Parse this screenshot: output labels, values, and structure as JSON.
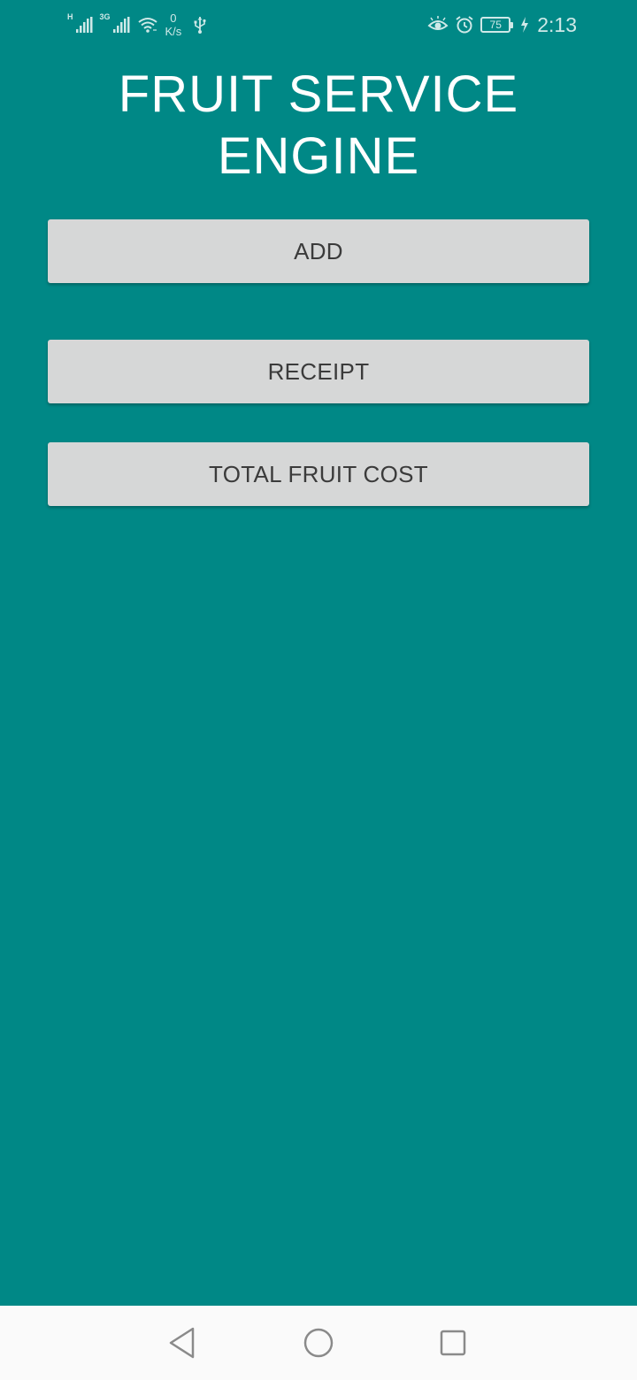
{
  "status_bar": {
    "network_1": "H",
    "network_2": "3G",
    "speed_value": "0",
    "speed_unit": "K/s",
    "battery": "75",
    "time": "2:13",
    "icons": [
      "signal-icon",
      "signal-icon",
      "wifi-icon",
      "usb-icon",
      "eye-comfort-icon",
      "alarm-icon",
      "battery-icon",
      "charging-icon"
    ]
  },
  "app": {
    "title_line1": "FRUIT SERVICE",
    "title_line2": "ENGINE"
  },
  "buttons": {
    "add": "ADD",
    "receipt": "RECEIPT",
    "total": "TOTAL FRUIT COST"
  },
  "nav": {
    "icons": [
      "back-icon",
      "home-icon",
      "recents-icon"
    ]
  },
  "colors": {
    "background": "#008886",
    "button": "#d6d7d7",
    "button_text": "#3b3b3b",
    "title": "#ffffff",
    "nav_bar": "#fafafa"
  }
}
